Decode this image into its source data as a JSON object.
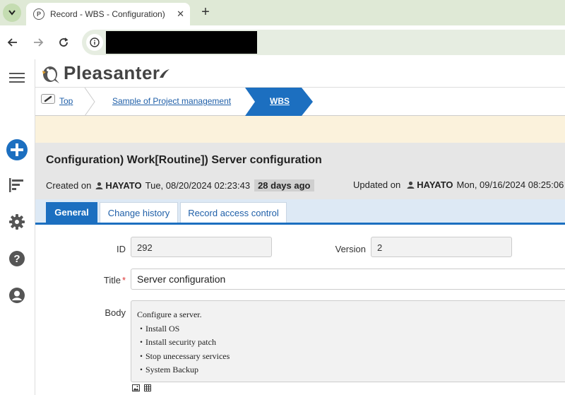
{
  "browser": {
    "tab_title": "Record - WBS - Configuration)",
    "favicon_letter": "P",
    "close_glyph": "✕",
    "new_tab_glyph": "+"
  },
  "app": {
    "logo_text": "Pleasanter"
  },
  "breadcrumb": {
    "items": [
      "Top",
      "Sample of Project management",
      "WBS"
    ]
  },
  "record": {
    "title": "Configuration)  Work[Routine])  Server configuration",
    "created_label": "Created on",
    "created_user": "HAYATO",
    "created_date": "Tue, 08/20/2024 02:23:43",
    "created_ago": "28 days ago",
    "updated_label": "Updated on",
    "updated_user": "HAYATO",
    "updated_date": "Mon, 09/16/2024 08:25:06"
  },
  "tabs": [
    "General",
    "Change history",
    "Record access control"
  ],
  "form": {
    "id_label": "ID",
    "id_value": "292",
    "version_label": "Version",
    "version_value": "2",
    "title_label": "Title",
    "title_required": "*",
    "title_value": "Server configuration",
    "body_label": "Body",
    "body_lines": [
      "Configure a server.",
      "・Install OS",
      "・Install security patch",
      "・Stop unecessary services",
      "・System Backup"
    ]
  },
  "colors": {
    "accent": "#1c6fc0",
    "message_bar": "#fbf2dc",
    "browser_chrome": "#dfe9d6"
  }
}
